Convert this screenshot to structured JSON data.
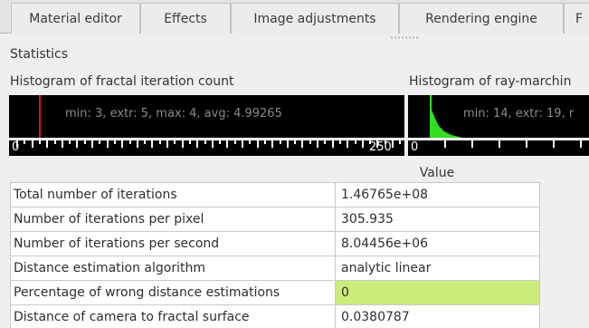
{
  "tabs": [
    {
      "label": "Material editor"
    },
    {
      "label": "Effects"
    },
    {
      "label": "Image adjustments"
    },
    {
      "label": "Rendering engine"
    },
    {
      "label": "F"
    }
  ],
  "statistics": {
    "title": "Statistics",
    "histogram_iterations": {
      "label": "Histogram of fractal iteration count",
      "summary": "min: 3, extr: 5, max: 4, avg: 4.99265",
      "axis_start": "0",
      "axis_end": "250",
      "marker_color": "#e01010"
    },
    "histogram_raymarching": {
      "label": "Histogram of ray-marchin",
      "summary": "min: 14, extr: 19, r",
      "axis_start": "0",
      "marker_color": "#33dd22"
    }
  },
  "table": {
    "value_header": "Value",
    "rows": [
      {
        "name": "Total number of iterations",
        "value": "1.46765e+08"
      },
      {
        "name": "Number of iterations per pixel",
        "value": "305.935"
      },
      {
        "name": "Number of iterations per second",
        "value": "8.04456e+06"
      },
      {
        "name": "Distance estimation algorithm",
        "value": "analytic linear"
      },
      {
        "name": "Percentage of wrong distance estimations",
        "value": "0"
      },
      {
        "name": "Distance of camera to fractal surface",
        "value": "0.0380787"
      }
    ],
    "highlight_color": "#ccec7c"
  }
}
